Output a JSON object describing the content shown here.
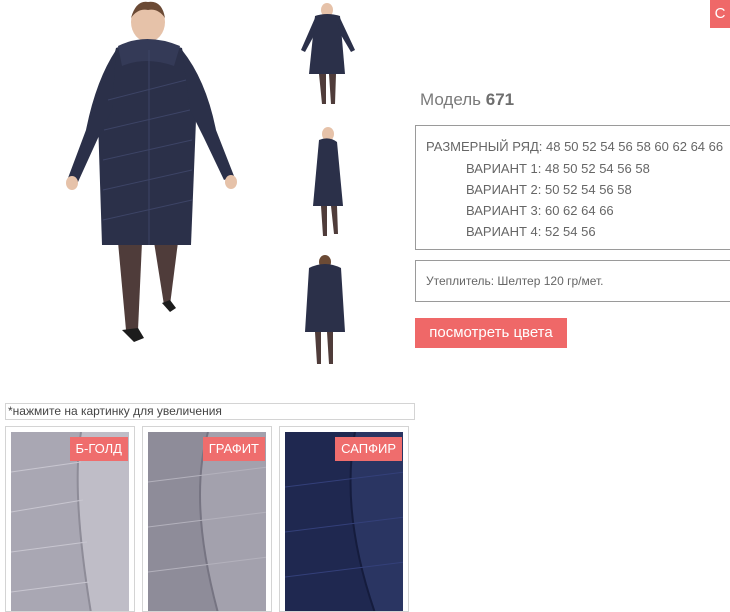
{
  "model": {
    "prefix": "Модель",
    "number": "671"
  },
  "specs": {
    "size_range": "РАЗМЕРНЫЙ РЯД: 48 50 52 54 56 58 60 62 64 66",
    "variant_1": "ВАРИАНТ 1: 48 50 52 54 56 58",
    "variant_2": "ВАРИАНТ 2: 50 52 54 56 58",
    "variant_3": "ВАРИАНТ 3: 60 62 64 66",
    "variant_4": "ВАРИАНТ 4: 52 54 56"
  },
  "insulation": "Утеплитель: Шелтер 120 гр/мет.",
  "view_colors_button": "посмотреть цвета",
  "corner_button": "С",
  "note": "*нажмите на картинку для увеличения",
  "swatches": [
    {
      "label": "Б-ГОЛД"
    },
    {
      "label": "ГРАФИТ"
    },
    {
      "label": "САПФИР"
    }
  ],
  "colors": {
    "accent": "#ef6868",
    "coat": "#2b3049",
    "b_gold": "#a9a7b3",
    "graphite": "#8e8c99",
    "sapphire": "#232c55"
  }
}
